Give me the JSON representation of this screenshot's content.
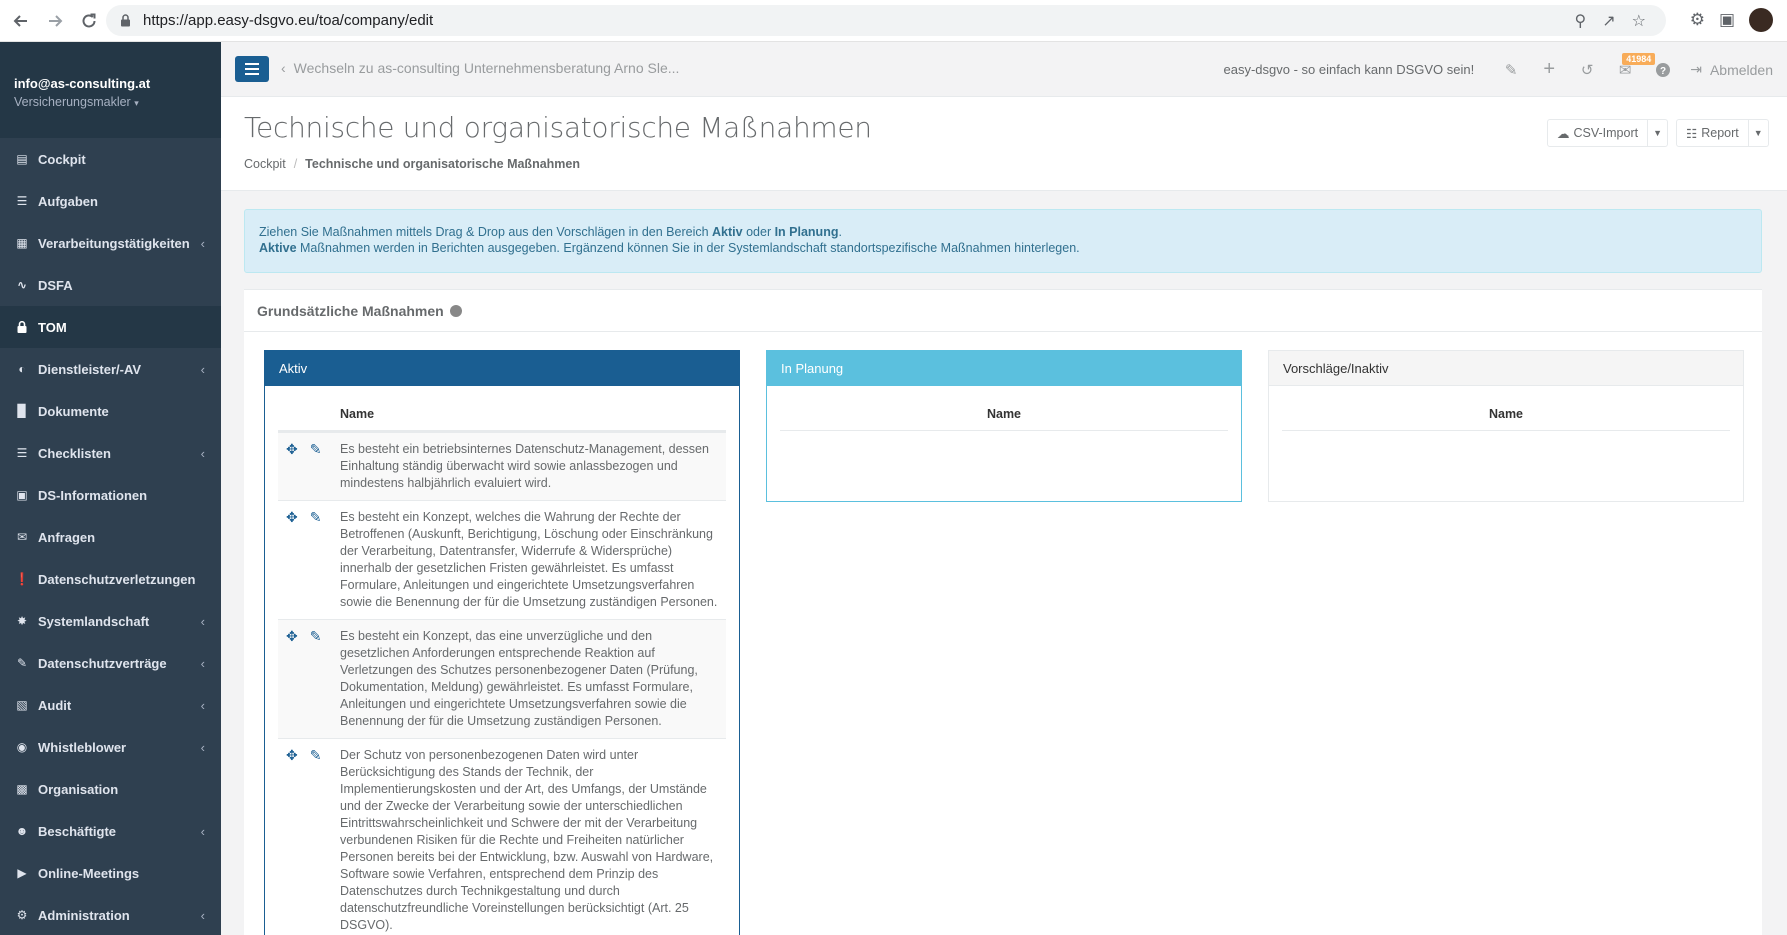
{
  "browser": {
    "url": "https://app.easy-dsgvo.eu/toa/company/edit"
  },
  "sidebar": {
    "user_email": "info@as-consulting.at",
    "user_role": "Versicherungsmakler",
    "items": [
      {
        "label": "Cockpit",
        "icon": "chart-icon",
        "chevron": false
      },
      {
        "label": "Aufgaben",
        "icon": "tasks-icon",
        "chevron": false
      },
      {
        "label": "Verarbeitungstätigkeiten",
        "icon": "list-icon",
        "chevron": true
      },
      {
        "label": "DSFA",
        "icon": "line-chart-icon",
        "chevron": false
      },
      {
        "label": "TOM",
        "icon": "lock-icon",
        "chevron": false,
        "active": true
      },
      {
        "label": "Dienstleister/-AV",
        "icon": "tachometer-icon",
        "chevron": true
      },
      {
        "label": "Dokumente",
        "icon": "folder-icon",
        "chevron": false
      },
      {
        "label": "Checklisten",
        "icon": "checklist-icon",
        "chevron": true
      },
      {
        "label": "DS-Informationen",
        "icon": "id-card-icon",
        "chevron": false
      },
      {
        "label": "Anfragen",
        "icon": "comments-icon",
        "chevron": false
      },
      {
        "label": "Datenschutzverletzungen",
        "icon": "exclamation-icon",
        "chevron": false
      },
      {
        "label": "Systemlandschaft",
        "icon": "network-icon",
        "chevron": true
      },
      {
        "label": "Datenschutzverträge",
        "icon": "contract-icon",
        "chevron": true
      },
      {
        "label": "Audit",
        "icon": "clipboard-icon",
        "chevron": true
      },
      {
        "label": "Whistleblower",
        "icon": "whistle-icon",
        "chevron": true
      },
      {
        "label": "Organisation",
        "icon": "building-icon",
        "chevron": false
      },
      {
        "label": "Beschäftigte",
        "icon": "users-icon",
        "chevron": true
      },
      {
        "label": "Online-Meetings",
        "icon": "video-icon",
        "chevron": false
      },
      {
        "label": "Administration",
        "icon": "cogs-icon",
        "chevron": true
      }
    ]
  },
  "topbar": {
    "switch_label": "Wechseln zu as-consulting Unternehmensberatung Arno Sle...",
    "slogan": "easy-dsgvo - so einfach kann DSGVO sein!",
    "mail_badge": "41984",
    "logout_label": "Abmelden"
  },
  "page": {
    "title": "Technische und organisatorische Maßnahmen",
    "breadcrumb_home": "Cockpit",
    "breadcrumb_current": "Technische und organisatorische Maßnahmen",
    "csv_import_label": "CSV-Import",
    "report_label": "Report"
  },
  "alert": {
    "line1_a": "Ziehen Sie Maßnahmen mittels Drag & Drop aus den Vorschlägen in den Bereich ",
    "line1_b": "Aktiv",
    "line1_c": " oder ",
    "line1_d": "In Planung",
    "line1_e": ".",
    "line2_a": "Aktive",
    "line2_b": " Maßnahmen werden in Berichten ausgegeben. Ergänzend können Sie in der Systemlandschaft standortspezifische Maßnahmen hinterlegen."
  },
  "section": {
    "title": "Grundsätzliche Maßnahmen"
  },
  "panels": {
    "aktiv": {
      "title": "Aktiv",
      "col_name": "Name",
      "rows": [
        "Es besteht ein betriebsinternes Datenschutz-Management, dessen Einhaltung ständig überwacht wird sowie anlassbezogen und mindestens halbjährlich evaluiert wird.",
        "Es besteht ein Konzept, welches die Wahrung der Rechte der Betroffenen (Auskunft, Berichtigung, Löschung oder Einschränkung der Verarbeitung, Datentransfer, Widerrufe & Widersprüche) innerhalb der gesetzlichen Fristen gewährleistet. Es umfasst Formulare, Anleitungen und eingerichtete Umsetzungsverfahren sowie die Benennung der für die Umsetzung zuständigen Personen.",
        "Es besteht ein Konzept, das eine unverzügliche und den gesetzlichen Anforderungen entsprechende Reaktion auf Verletzungen des Schutzes personenbezogener Daten (Prüfung, Dokumentation, Meldung) gewährleistet. Es umfasst Formulare, Anleitungen und eingerichtete Umsetzungsverfahren sowie die Benennung der für die Umsetzung zuständigen Personen.",
        "Der Schutz von personenbezogenen Daten wird unter Berücksichtigung des Stands der Technik, der Implementierungskosten und der Art, des Umfangs, der Umstände und der Zwecke der Verarbeitung sowie der unterschiedlichen Eintrittswahrscheinlichkeit und Schwere der mit der Verarbeitung verbundenen Risiken für die Rechte und Freiheiten natürlicher Personen bereits bei der Entwicklung, bzw. Auswahl von Hardware, Software sowie Verfahren, entsprechend dem Prinzip des Datenschutzes durch Technikgestaltung und durch datenschutzfreundliche Voreinstellungen berücksichtigt (Art. 25 DSGVO)."
      ]
    },
    "planung": {
      "title": "In Planung",
      "col_name": "Name"
    },
    "vorschlag": {
      "title": "Vorschläge/Inaktiv",
      "col_name": "Name"
    }
  },
  "colors": {
    "sidebar_bg": "#2f4050",
    "primary": "#1a5e92",
    "info": "#5bc0de",
    "badge": "#f8ac59"
  }
}
